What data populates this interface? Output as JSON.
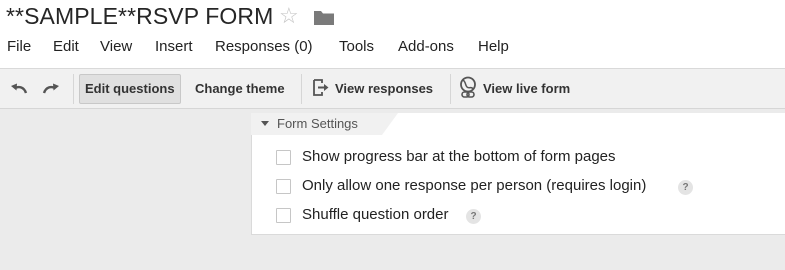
{
  "document": {
    "title": "**SAMPLE**RSVP FORM",
    "star_icon": "star-outline-icon",
    "folder_icon": "folder-icon"
  },
  "menu": {
    "items": [
      "File",
      "Edit",
      "View",
      "Insert",
      "Responses (0)",
      "Tools",
      "Add-ons",
      "Help"
    ]
  },
  "toolbar": {
    "undo_icon": "undo-icon",
    "redo_icon": "redo-icon",
    "edit_questions": "Edit questions",
    "change_theme": "Change theme",
    "view_responses": "View responses",
    "view_responses_icon": "export-icon",
    "view_live_form": "View live form",
    "view_live_form_icon": "globe-link-icon"
  },
  "form_settings": {
    "header": "Form Settings",
    "options": [
      {
        "label": "Show progress bar at the bottom of form pages",
        "checked": false,
        "has_help": false
      },
      {
        "label": "Only allow one response per person (requires login)",
        "checked": false,
        "has_help": true
      },
      {
        "label": "Shuffle question order",
        "checked": false,
        "has_help": true
      }
    ],
    "help_glyph": "?"
  },
  "colors": {
    "background": "#ebebeb",
    "toolbar": "#f1f1f1",
    "panel": "#ffffff"
  }
}
